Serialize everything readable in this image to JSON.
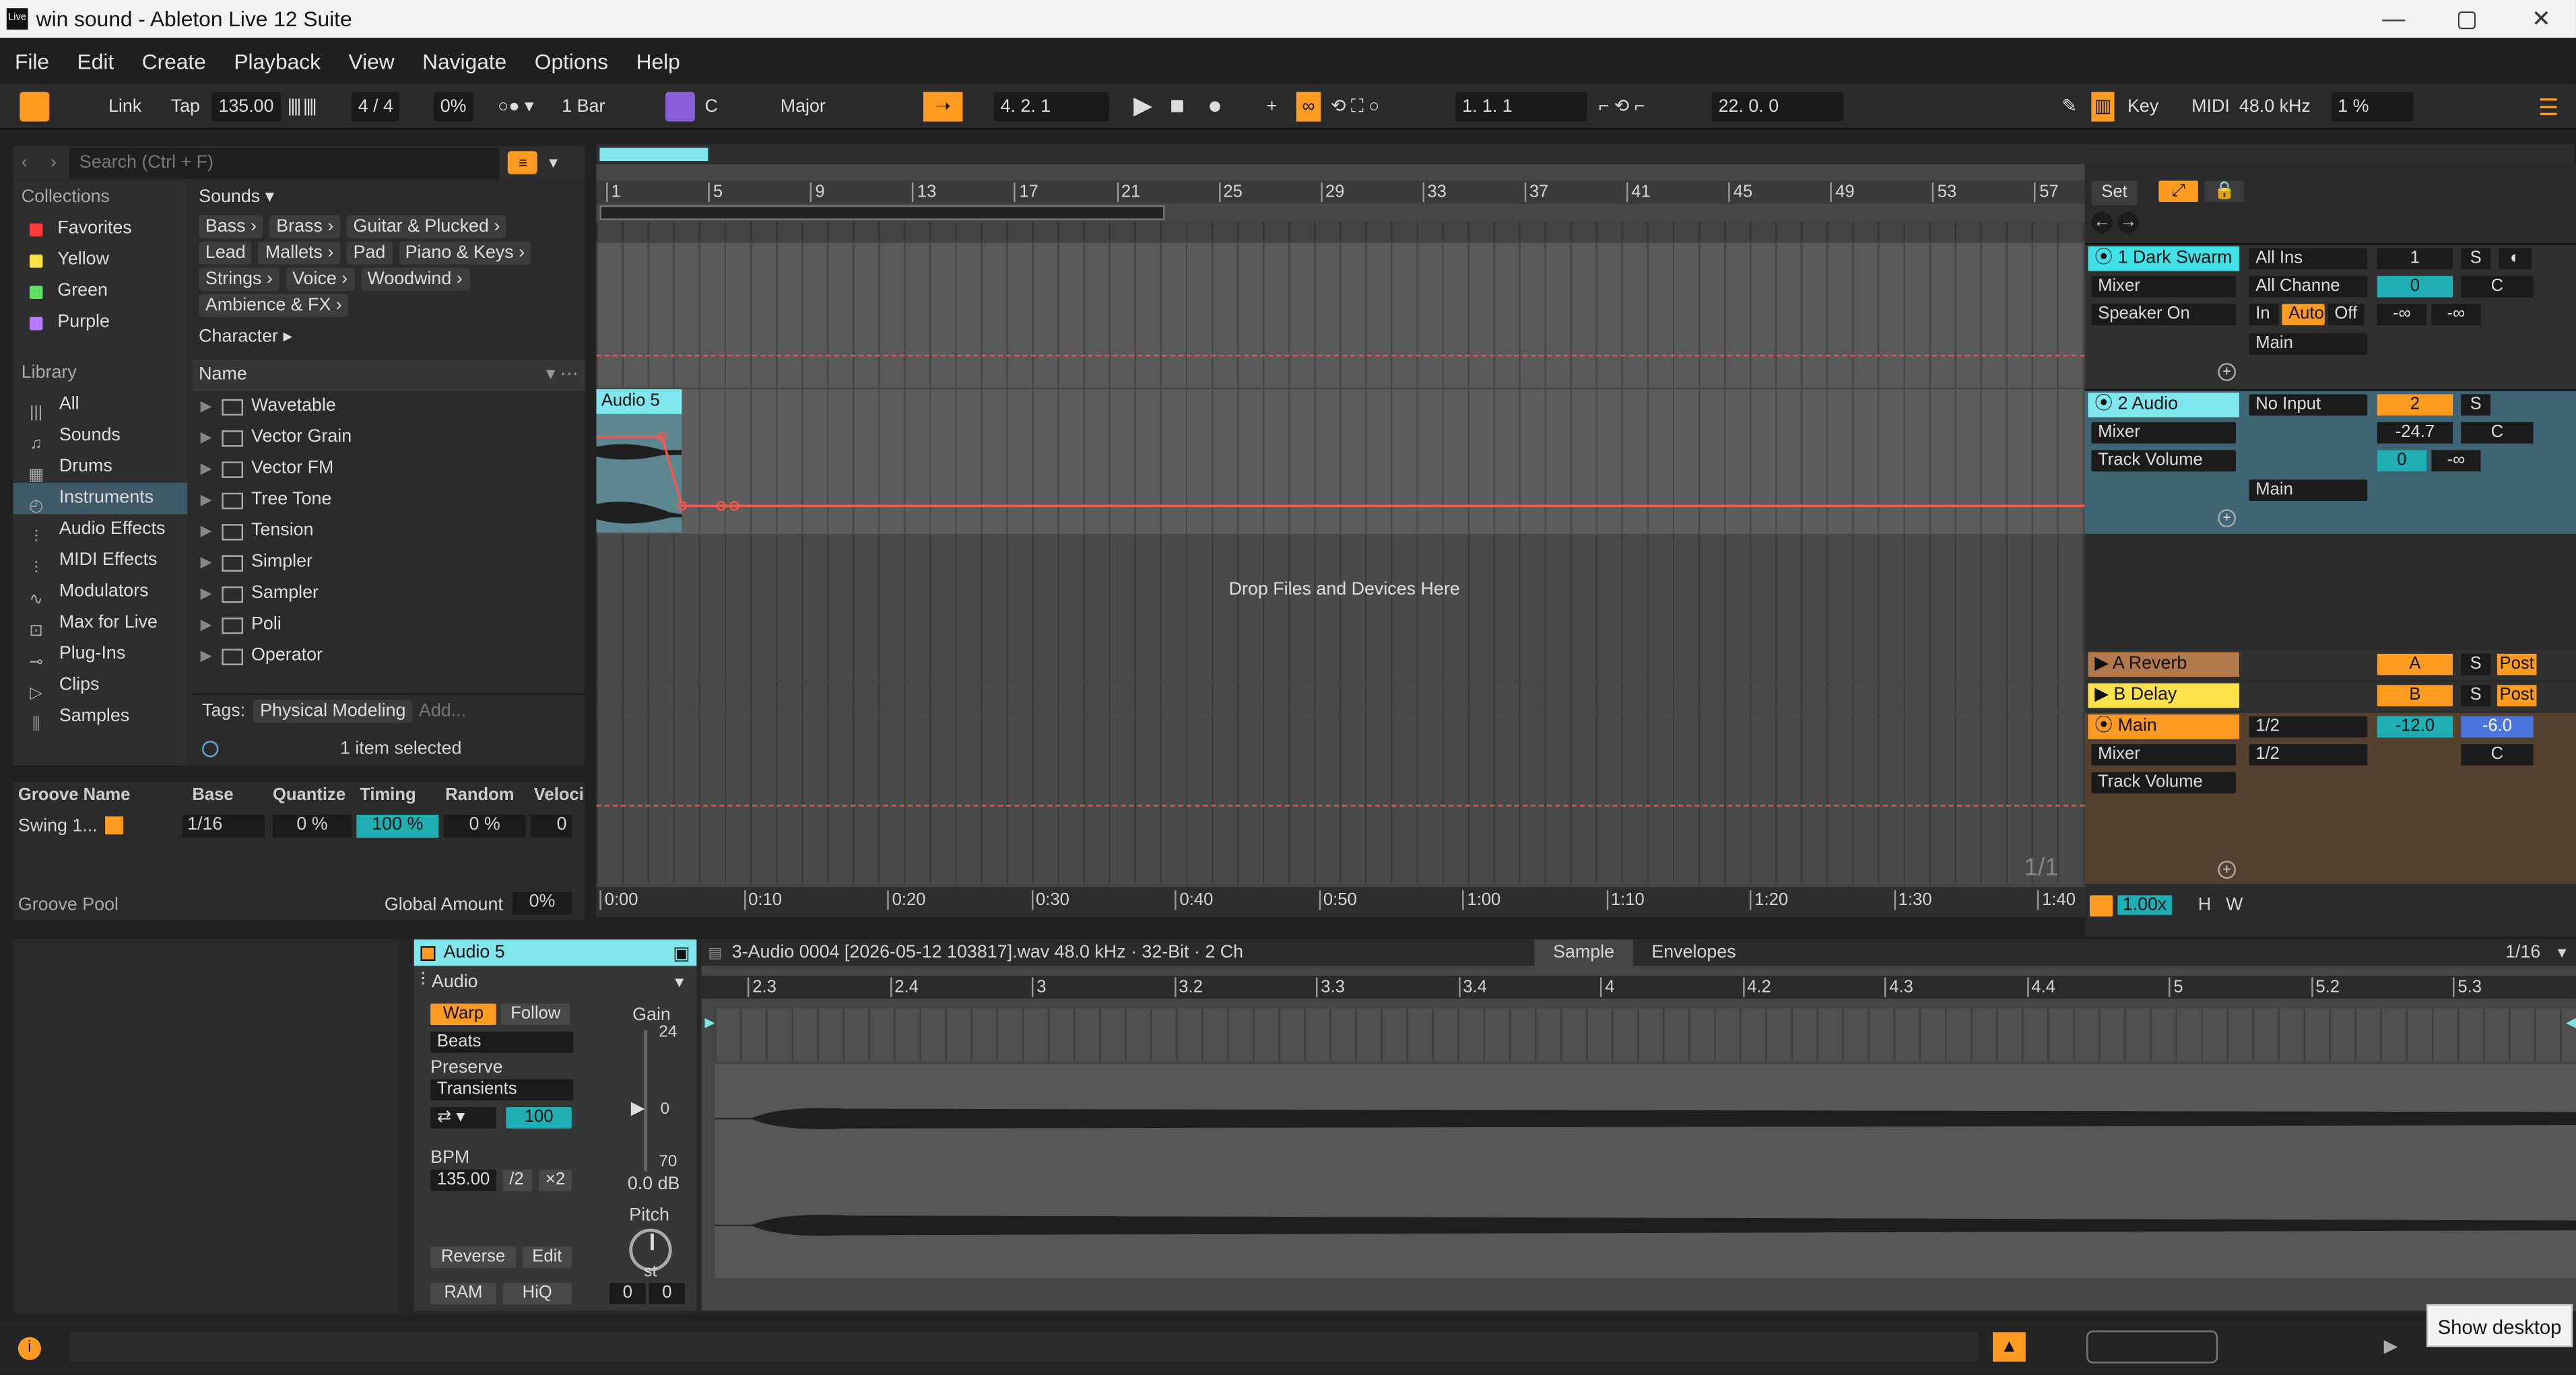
{
  "window": {
    "title": "win sound - Ableton Live 12 Suite",
    "controls": {
      "minimize": "—",
      "maximize": "▢",
      "close": "✕"
    }
  },
  "menu": [
    "File",
    "Edit",
    "Create",
    "Playback",
    "View",
    "Navigate",
    "Options",
    "Help"
  ],
  "transport": {
    "link": "Link",
    "tap": "Tap",
    "tempo": "135.00",
    "signature": "4 / 4",
    "swing": "0%",
    "quantize": "1 Bar",
    "key_root": "C",
    "scale": "Major",
    "position": "4.   2.   1",
    "loop_start": "1.   1.   1",
    "loop_length": "22.   0.   0",
    "key_label": "Key",
    "midi_label": "MIDI",
    "sample_rate": "48.0 kHz",
    "cpu": "1 %"
  },
  "browser": {
    "search_placeholder": "Search (Ctrl + F)",
    "collections_header": "Collections",
    "collections": [
      {
        "label": "Favorites",
        "color": "#ff3a3a"
      },
      {
        "label": "Yellow",
        "color": "#ffe14a"
      },
      {
        "label": "Green",
        "color": "#5ee05e"
      },
      {
        "label": "Purple",
        "color": "#b57cff"
      }
    ],
    "library_header": "Library",
    "library": [
      {
        "label": "All",
        "icon": "bars-icon"
      },
      {
        "label": "Sounds",
        "icon": "note-icon"
      },
      {
        "label": "Drums",
        "icon": "drums-icon"
      },
      {
        "label": "Instruments",
        "icon": "clock-icon"
      },
      {
        "label": "Audio Effects",
        "icon": "audio-fx-icon"
      },
      {
        "label": "MIDI Effects",
        "icon": "midi-fx-icon"
      },
      {
        "label": "Modulators",
        "icon": "wave-icon"
      },
      {
        "label": "Max for Live",
        "icon": "max-icon"
      },
      {
        "label": "Plug-Ins",
        "icon": "plugin-icon"
      },
      {
        "label": "Clips",
        "icon": "clip-icon"
      },
      {
        "label": "Samples",
        "icon": "sample-icon"
      }
    ],
    "sounds_header": "Sounds ▾",
    "sound_tags": [
      [
        "Bass ›",
        "Brass ›",
        "Guitar & Plucked ›"
      ],
      [
        "Lead",
        "Mallets ›",
        "Pad",
        "Piano & Keys ›"
      ],
      [
        "Strings ›",
        "Voice ›",
        "Woodwind ›"
      ],
      [
        "Ambience & FX ›"
      ]
    ],
    "character": "Character ▸",
    "name_header": "Name",
    "items": [
      "Wavetable",
      "Vector Grain",
      "Vector FM",
      "Tree Tone",
      "Tension",
      "Simpler",
      "Sampler",
      "Poli",
      "Operator"
    ],
    "tags_label": "Tags:",
    "tag_value": "Physical Modeling",
    "tag_add": "Add...",
    "status": "1 item selected"
  },
  "groove": {
    "headers": [
      "Groove Name",
      "Base",
      "Quantize",
      "Timing",
      "Random",
      "Veloci"
    ],
    "row": {
      "name": "Swing 1...",
      "base": "1/16",
      "quantize": "0 %",
      "timing": "100 %",
      "random": "0 %",
      "velocity": "0"
    },
    "pool_label": "Groove Pool",
    "global_amount_label": "Global Amount",
    "global_amount": "0%"
  },
  "arrangement": {
    "bars": [
      "1",
      "5",
      "9",
      "13",
      "17",
      "21",
      "25",
      "29",
      "33",
      "37",
      "41",
      "45",
      "49",
      "53",
      "57"
    ],
    "set_label": "Set",
    "clip_name": "Audio 5",
    "drop_text": "Drop Files and Devices Here",
    "page": "1/1",
    "times": [
      "0:00",
      "0:10",
      "0:20",
      "0:30",
      "0:40",
      "0:50",
      "1:00",
      "1:10",
      "1:20",
      "1:30",
      "1:40"
    ]
  },
  "tracks": [
    {
      "name": "1 Dark Swarm",
      "color": "#3fe0e6",
      "input": "All Ins",
      "channel": "All Channe",
      "mixer": "Mixer",
      "sub": "Speaker On",
      "number": "1",
      "s": "S",
      "vol": "0",
      "pan": "C",
      "mon_in": "In",
      "mon_auto": "Auto",
      "mon_off": "Off",
      "inf1": "-∞",
      "inf2": "-∞",
      "out": "Main"
    },
    {
      "name": "2 Audio",
      "color": "#3fe0e6",
      "input": "No Input",
      "mixer": "Mixer",
      "sub": "Track Volume",
      "number": "2",
      "s": "S",
      "vol": "-24.7",
      "pan": "C",
      "send": "0",
      "inf": "-∞",
      "out": "Main"
    }
  ],
  "returns": [
    {
      "name": "A Reverb",
      "color": "#b2794b",
      "letter": "A",
      "s": "S",
      "post": "Post"
    },
    {
      "name": "B Delay",
      "color": "#ffe24a",
      "letter": "B",
      "s": "S",
      "post": "Post"
    },
    {
      "name": "Main",
      "color": "#ff9b21",
      "io1": "1/2",
      "io2": "1/2",
      "vol": "-12.0",
      "pan_val": "-6.0",
      "pan": "C",
      "mixer": "Mixer",
      "sub": "Track Volume"
    }
  ],
  "mixer_footer": {
    "zoom": "1.00x",
    "h": "H",
    "w": "W"
  },
  "clip_detail": {
    "clip_name": "Audio 5",
    "type": "Audio",
    "warp": "Warp",
    "follow": "Follow",
    "warp_mode": "Beats",
    "preserve_label": "Preserve",
    "preserve": "Transients",
    "loop_val": "100",
    "bpm_label": "BPM",
    "bpm": "135.00",
    "half": "/2",
    "double": "×2",
    "gain_label": "Gain",
    "gain_max": "24",
    "gain_zero": "0",
    "gain_min": "70",
    "gain_db": "0.0 dB",
    "pitch_label": "Pitch",
    "pitch_unit": "st",
    "pitch_coarse": "0",
    "pitch_fine": "0",
    "reverse": "Reverse",
    "edit": "Edit",
    "ram": "RAM",
    "hiq": "HiQ",
    "file_info": "3-Audio 0004 [2026-05-12 103817].wav  48.0 kHz · 32-Bit · 2 Ch",
    "tab_sample": "Sample",
    "tab_envelopes": "Envelopes",
    "grid": "1/16",
    "ruler": [
      "2.3",
      "2.4",
      "3",
      "3.2",
      "3.3",
      "3.4",
      "4",
      "4.2",
      "4.3",
      "4.4",
      "5",
      "5.2",
      "5.3"
    ]
  },
  "tooltip": "Show desktop"
}
